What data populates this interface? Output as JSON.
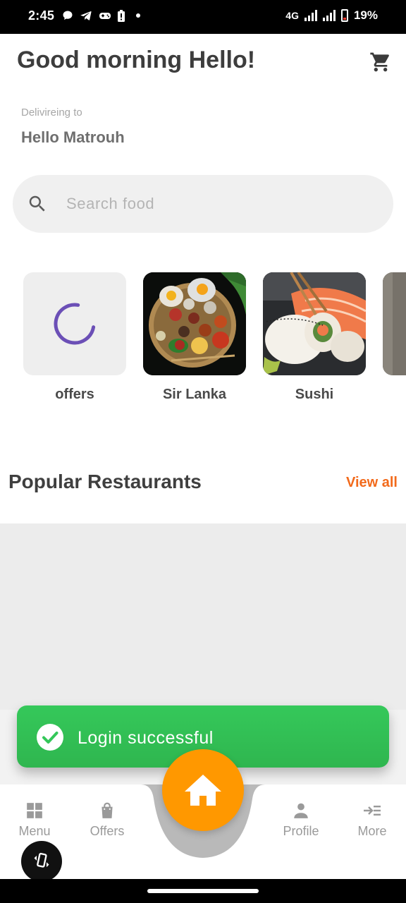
{
  "status_bar": {
    "time": "2:45",
    "network": "4G",
    "battery": "19%"
  },
  "header": {
    "greeting": "Good morning Hello!",
    "cart_icon": "cart-icon"
  },
  "delivery": {
    "label": "Delivireing to",
    "location": "Hello Matrouh"
  },
  "search": {
    "placeholder": "Search food",
    "value": ""
  },
  "categories": [
    {
      "label": "offers",
      "state": "loading"
    },
    {
      "label": "Sir Lanka",
      "image": "sri-lankan-platter"
    },
    {
      "label": "Sushi",
      "image": "sushi-rolls"
    }
  ],
  "popular": {
    "title": "Popular Restaurants",
    "view_all": "View all"
  },
  "toast": {
    "message": "Login successful",
    "color": "#34C759"
  },
  "bottom_nav": {
    "items": [
      {
        "label": "Menu",
        "icon": "grid-icon"
      },
      {
        "label": "Offers",
        "icon": "shopping-bag-icon"
      },
      {
        "label": "Profile",
        "icon": "person-icon"
      },
      {
        "label": "More",
        "icon": "more-menu-icon"
      }
    ],
    "home_icon": "home-icon",
    "accent": "#FF9800"
  },
  "colors": {
    "accent_orange": "#F26A1B",
    "home_orange": "#FF9800",
    "toast_green": "#34C759",
    "spinner_purple": "#6B4FB6"
  }
}
